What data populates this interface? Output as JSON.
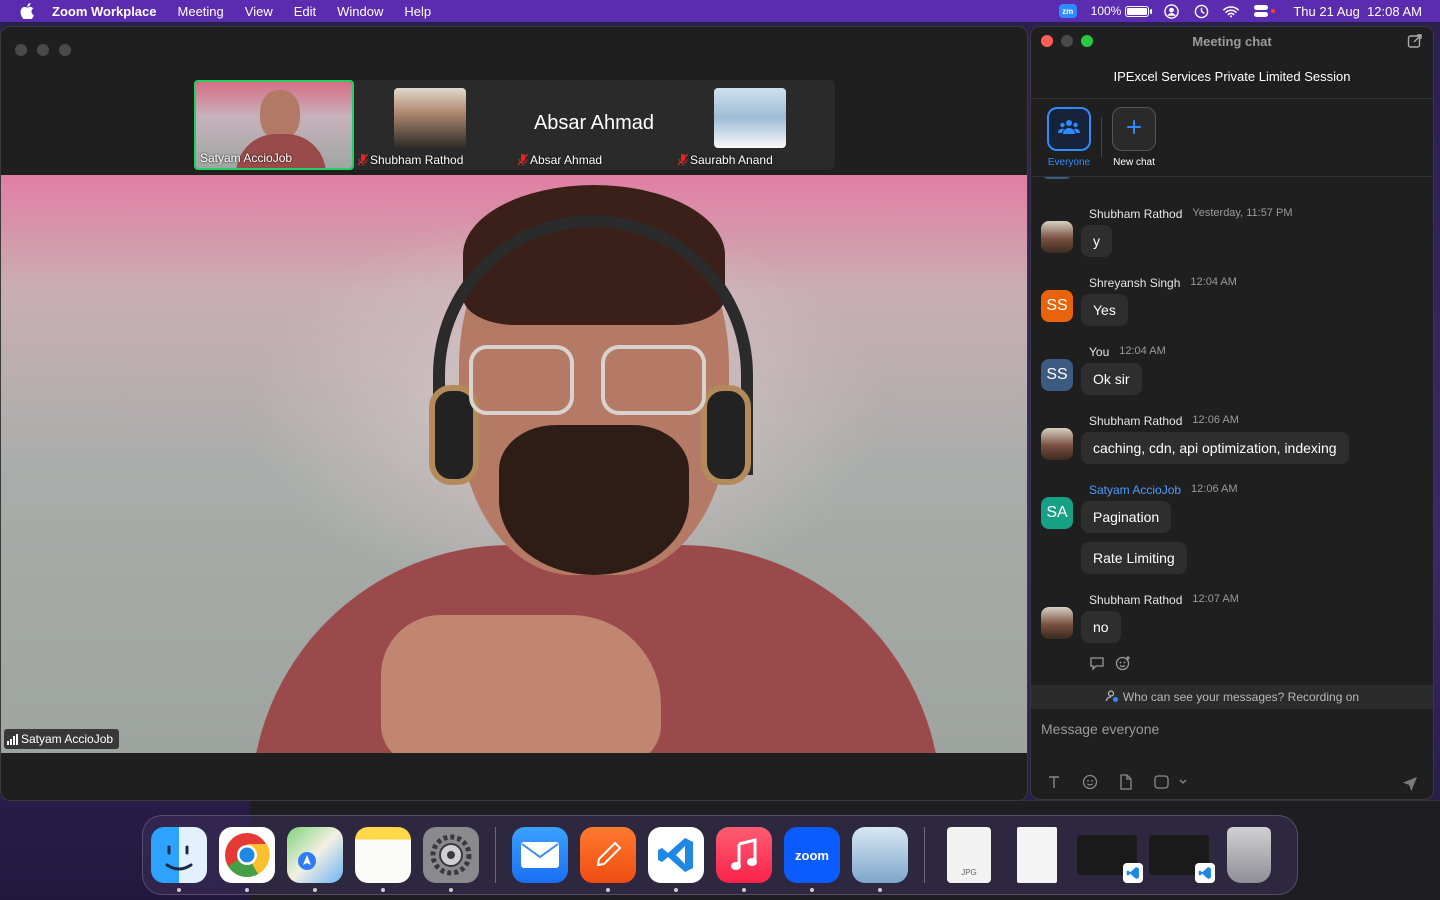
{
  "menubar": {
    "app_name": "Zoom Workplace",
    "items": [
      "Meeting",
      "View",
      "Edit",
      "Window",
      "Help"
    ],
    "battery_percent": "100%",
    "battery_level": 1.0,
    "clock": "Thu 21 Aug  12:08 AM",
    "zoom_badge": "zm"
  },
  "meeting": {
    "thumbnails": [
      {
        "name": "Satyam AccioJob",
        "active": true,
        "muted": false
      },
      {
        "name": "Shubham Rathod",
        "active": false,
        "muted": true
      },
      {
        "name": "Absar Ahmad",
        "display_name": "Absar Ahmad",
        "active": false,
        "muted": true
      },
      {
        "name": "Saurabh Anand",
        "active": false,
        "muted": true
      }
    ],
    "active_speaker": "Satyam AccioJob"
  },
  "chat": {
    "window_title": "Meeting chat",
    "session_title": "IPExcel Services Private Limited Session",
    "recipients": [
      {
        "label": "Everyone",
        "selected": true
      },
      {
        "label": "New chat",
        "selected": false
      }
    ],
    "messages": [
      {
        "sender": "Shubham Rathod",
        "time": "Yesterday, 11:57 PM",
        "avatar": "photo",
        "texts": [
          "y"
        ]
      },
      {
        "sender": "Shreyansh Singh",
        "time": "12:04 AM",
        "avatar": "SS",
        "texts": [
          "Yes"
        ]
      },
      {
        "sender": "You",
        "time": "12:04 AM",
        "avatar": "SS",
        "texts": [
          "Ok sir"
        ]
      },
      {
        "sender": "Shubham Rathod",
        "time": "12:06 AM",
        "avatar": "photo",
        "texts": [
          "caching, cdn, api optimization, indexing"
        ]
      },
      {
        "sender": "Satyam AccioJob",
        "time": "12:06 AM",
        "avatar": "SA",
        "texts": [
          "Pagination",
          "Rate Limiting"
        ]
      },
      {
        "sender": "Shubham Rathod",
        "time": "12:07 AM",
        "avatar": "photo",
        "texts": [
          "no"
        ]
      }
    ],
    "notice": "Who can see your messages? Recording on",
    "input_placeholder": "Message everyone",
    "colors": {
      "accent": "#2d8cff",
      "host_name": "#4a9bff"
    }
  },
  "dock": {
    "apps": [
      "finder",
      "chrome",
      "maps",
      "notes",
      "system-settings",
      "mail",
      "pen-app",
      "vscode",
      "music",
      "zoom",
      "preview",
      "jpg-file",
      "document",
      "vscode-window-1",
      "vscode-window-2",
      "trash"
    ],
    "zoom_label": "zoom",
    "jpg_label": "JPG"
  }
}
